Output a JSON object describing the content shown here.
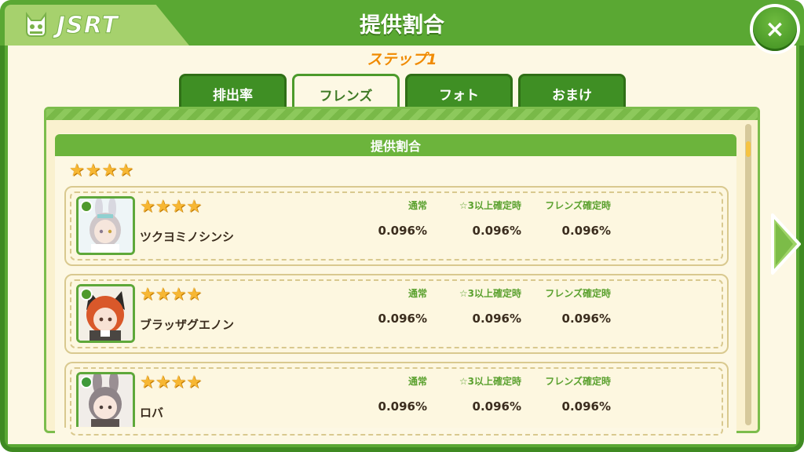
{
  "header": {
    "logo_text": "JSRT",
    "title": "提供割合",
    "close_label": "×"
  },
  "step_label": "ステップ1",
  "tabs": [
    {
      "label": "排出率",
      "active": false
    },
    {
      "label": "フレンズ",
      "active": true
    },
    {
      "label": "フォト",
      "active": false
    },
    {
      "label": "おまけ",
      "active": false
    }
  ],
  "section_title": "提供割合",
  "group_rarity_stars": 4,
  "columns": [
    "通常",
    "☆3以上確定時",
    "フレンズ確定時"
  ],
  "friends": [
    {
      "name": "ツクヨミノシンシ",
      "stars": 4,
      "rates": [
        "0.096%",
        "0.096%",
        "0.096%"
      ],
      "attribute_icon": "funny-icon"
    },
    {
      "name": "ブラッザグエノン",
      "stars": 4,
      "rates": [
        "0.096%",
        "0.096%",
        "0.096%"
      ],
      "attribute_icon": "funny-icon"
    },
    {
      "name": "ロバ",
      "stars": 4,
      "rates": [
        "0.096%",
        "0.096%",
        "0.096%"
      ],
      "attribute_icon": "relax-icon"
    }
  ],
  "colors": {
    "frame_green": "#5aa833",
    "panel_cream": "#fdf8e4",
    "step_orange": "#f08a00",
    "star_gold": "#f7b733"
  }
}
